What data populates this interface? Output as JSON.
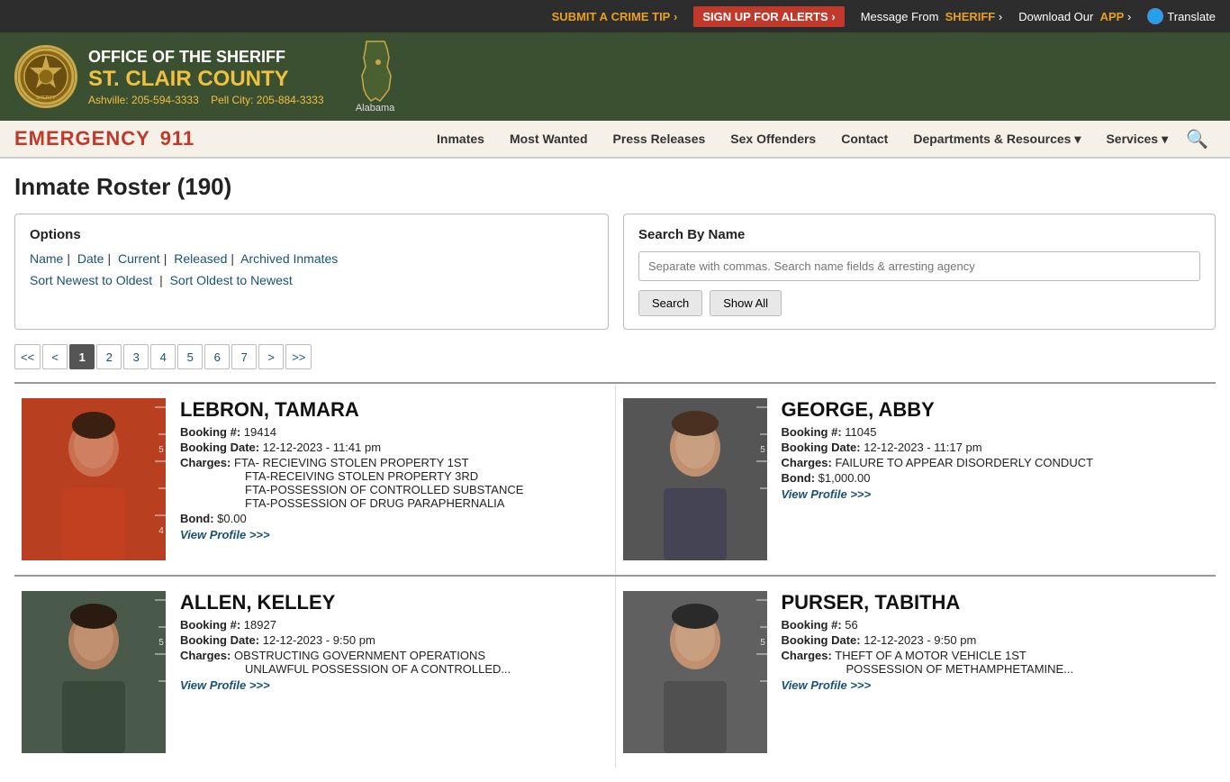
{
  "top_banner": {
    "crime_tip_label": "SUBMIT A",
    "crime_tip_link": "CRIME TIP",
    "crime_tip_arrow": "›",
    "alerts_label": "SIGN UP FOR ALERTS",
    "alerts_arrow": "›",
    "sheriff_msg": "Message From",
    "sheriff_name": "SHERIFF",
    "sheriff_arrow": "›",
    "download_label": "Download Our",
    "download_app": "APP",
    "download_arrow": "›",
    "translate_label": "Translate"
  },
  "header": {
    "office_line1": "OFFICE OF THE SHERIFF",
    "county_name": "ST. CLAIR COUNTY",
    "city1_label": "Ashville:",
    "city1_phone": "205-594-3333",
    "city2_label": "Pell City:",
    "city2_phone": "205-884-3333",
    "state_label": "Alabama",
    "badge_text": "ST. CLAIR COUNTY"
  },
  "main_nav": {
    "emergency_label": "EMERGENCY",
    "emergency_number": "911",
    "nav_items": [
      {
        "label": "Inmates",
        "href": "#"
      },
      {
        "label": "Most Wanted",
        "href": "#"
      },
      {
        "label": "Press Releases",
        "href": "#"
      },
      {
        "label": "Sex Offenders",
        "href": "#"
      },
      {
        "label": "Contact",
        "href": "#"
      }
    ],
    "dept_resources": "Departments & Resources",
    "services": "Services"
  },
  "page": {
    "title": "Inmate Roster (190)"
  },
  "options": {
    "heading": "Options",
    "links": [
      {
        "label": "Name",
        "href": "#"
      },
      {
        "label": "Date",
        "href": "#"
      },
      {
        "label": "Current",
        "href": "#"
      },
      {
        "label": "Released",
        "href": "#"
      },
      {
        "label": "Archived Inmates",
        "href": "#"
      }
    ],
    "sort_links": [
      {
        "label": "Sort Newest to Oldest",
        "href": "#"
      },
      {
        "label": "Sort Oldest to Newest",
        "href": "#"
      }
    ]
  },
  "search": {
    "heading": "Search By Name",
    "placeholder": "Separate with commas. Search name fields & arresting agency",
    "search_btn": "Search",
    "show_all_btn": "Show All"
  },
  "pagination": {
    "first": "<<",
    "prev": "<",
    "pages": [
      "1",
      "2",
      "3",
      "4",
      "5",
      "6",
      "7"
    ],
    "current_page": "1",
    "next": ">",
    "last": ">>"
  },
  "inmates": [
    {
      "name": "LEBRON, TAMARA",
      "booking_num": "19414",
      "booking_date": "12-12-2023 - 11:41 pm",
      "charges": [
        "FTA- RECIEVING STOLEN PROPERTY 1ST",
        "FTA-RECEIVING STOLEN PROPERTY 3RD",
        "FTA-POSSESSION OF CONTROLLED SUBSTANCE",
        "FTA-POSSESSION OF DRUG PARAPHERNALIA"
      ],
      "bond": "$0.00",
      "view_profile_label": "View Profile >>>",
      "mugshot_class": "mugshot-1"
    },
    {
      "name": "GEORGE, ABBY",
      "booking_num": "11045",
      "booking_date": "12-12-2023 - 11:17 pm",
      "charges": [
        "FAILURE TO APPEAR DISORDERLY CONDUCT"
      ],
      "bond": "$1,000.00",
      "view_profile_label": "View Profile >>>",
      "mugshot_class": "mugshot-2"
    },
    {
      "name": "ALLEN, KELLEY",
      "booking_num": "18927",
      "booking_date": "12-12-2023 - 9:50 pm",
      "charges": [
        "OBSTRUCTING GOVERNMENT OPERATIONS",
        "UNLAWFUL POSSESSION OF A CONTROLLED..."
      ],
      "bond": "",
      "view_profile_label": "View Profile >>>",
      "mugshot_class": "mugshot-3"
    },
    {
      "name": "PURSER, TABITHA",
      "booking_num": "56",
      "booking_date": "12-12-2023 - 9:50 pm",
      "charges": [
        "THEFT OF A MOTOR VEHICLE 1ST",
        "POSSESSION OF METHAMPHETAMINE..."
      ],
      "bond": "",
      "view_profile_label": "View Profile >>>",
      "mugshot_class": "mugshot-4"
    }
  ],
  "labels": {
    "booking_num": "Booking #:",
    "booking_date": "Booking Date:",
    "charges": "Charges:",
    "bond": "Bond:"
  }
}
